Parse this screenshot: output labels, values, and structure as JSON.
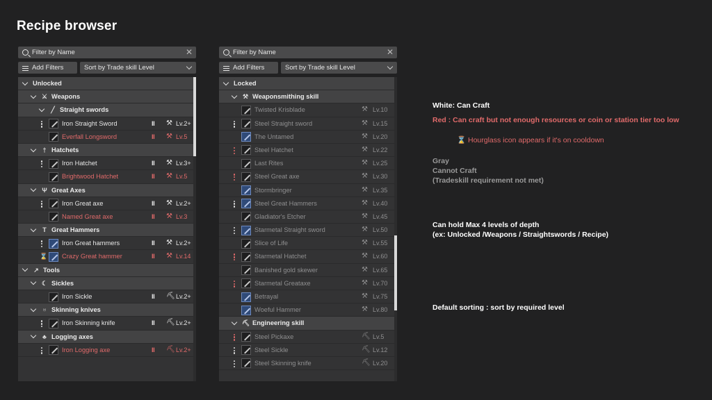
{
  "title": "Recipe browser",
  "colors": {
    "background": "#212122",
    "panel": "#333334",
    "header": "#434344",
    "red": "#e06a6a",
    "gray": "#8f8f90",
    "white": "#e6e6e6"
  },
  "left_panel": {
    "search_placeholder": "Filter by Name",
    "add_filters": "Add Filters",
    "sort": "Sort by Trade skill Level",
    "groups": [
      {
        "label": "Unlocked",
        "level": 1
      },
      {
        "label": "Weapons",
        "level": 2,
        "icon": "crossed-swords-icon"
      },
      {
        "label": "Straight swords",
        "level": 3,
        "icon": "sword-icon"
      },
      {
        "name": "Iron Straight Sword",
        "status": "white",
        "level": "Lv.2+",
        "dots": true
      },
      {
        "name": "Everfall Longsword",
        "status": "red",
        "level": "Lv.5",
        "dots": false
      },
      {
        "label": "Hatchets",
        "level": 2,
        "icon": "hatchet-icon"
      },
      {
        "name": "Iron Hatchet",
        "status": "white",
        "level": "Lv.3+",
        "dots": true
      },
      {
        "name": "Brightwood Hatchet",
        "status": "red",
        "level": "Lv.5",
        "dots": false
      },
      {
        "label": "Great Axes",
        "level": 2,
        "icon": "great-axe-icon"
      },
      {
        "name": "Iron Great axe",
        "status": "white",
        "level": "Lv.2+",
        "dots": true
      },
      {
        "name": "Named Great axe",
        "status": "red",
        "level": "Lv.3",
        "dots": false
      },
      {
        "label": "Great Hammers",
        "level": 2,
        "icon": "hammer-icon"
      },
      {
        "name": "Iron Great hammers",
        "status": "white",
        "level": "Lv.2+",
        "dots": true
      },
      {
        "name": "Crazy Great hammer",
        "status": "red",
        "level": "Lv.14",
        "dots": false,
        "cooldown": true
      },
      {
        "label": "Tools",
        "level": 1,
        "icon": "tools-icon"
      },
      {
        "label": "Sickles",
        "level": 2,
        "icon": "sickle-icon"
      },
      {
        "name": "Iron Sickle",
        "status": "white",
        "level": "Lv.2+",
        "dots": false
      },
      {
        "label": "Skinning knives",
        "level": 2,
        "icon": "knife-icon"
      },
      {
        "name": "Iron Skinning knife",
        "status": "white",
        "level": "Lv.2+",
        "dots": true
      },
      {
        "label": "Logging axes",
        "level": 2,
        "icon": "tree-icon"
      },
      {
        "name": "Iron Logging axe",
        "status": "red",
        "level": "Lv.2+",
        "dots": true
      }
    ]
  },
  "right_panel": {
    "search_placeholder": "Filter by Name",
    "add_filters": "Add Filters",
    "sort": "Sort by Trade skill Level",
    "groups": [
      {
        "label": "Locked",
        "level": 1
      },
      {
        "label": "Weaponsmithing skill",
        "level": 2,
        "icon": "anvil-icon"
      },
      {
        "name": "Twisted Krisblade",
        "level": "Lv.10",
        "dots": false,
        "icon_color": "dark"
      },
      {
        "name": "Steel Straight sword",
        "level": "Lv.15",
        "dots": true,
        "icon_color": "dark"
      },
      {
        "name": "The Untamed",
        "level": "Lv.20",
        "dots": false,
        "icon_color": "blue"
      },
      {
        "name": "Steel Hatchet",
        "level": "Lv.22",
        "dots": true,
        "dots_red": true,
        "icon_color": "dark"
      },
      {
        "name": "Last Rites",
        "level": "Lv.25",
        "dots": false,
        "icon_color": "dark"
      },
      {
        "name": "Steel Great axe",
        "level": "Lv.30",
        "dots": true,
        "dots_red": true,
        "icon_color": "dark"
      },
      {
        "name": "Stormbringer",
        "level": "Lv.35",
        "dots": false,
        "icon_color": "blue"
      },
      {
        "name": "Steel Great Hammers",
        "level": "Lv.40",
        "dots": true,
        "icon_color": "blue"
      },
      {
        "name": "Gladiator's Etcher",
        "level": "Lv.45",
        "dots": false,
        "icon_color": "dark"
      },
      {
        "name": "Starmetal Straight sword",
        "level": "Lv.50",
        "dots": true,
        "icon_color": "blue"
      },
      {
        "name": "Slice of Life",
        "level": "Lv.55",
        "dots": false,
        "icon_color": "dark"
      },
      {
        "name": "Starmetal Hatchet",
        "level": "Lv.60",
        "dots": true,
        "dots_red": true,
        "icon_color": "dark"
      },
      {
        "name": "Banished gold skewer",
        "level": "Lv.65",
        "dots": false,
        "icon_color": "dark"
      },
      {
        "name": "Starmetal Greataxe",
        "level": "Lv.70",
        "dots": true,
        "dots_red": true,
        "icon_color": "dark"
      },
      {
        "name": "Betrayal",
        "level": "Lv.75",
        "dots": false,
        "icon_color": "blue"
      },
      {
        "name": "Woeful Hammer",
        "level": "Lv.80",
        "dots": false,
        "icon_color": "blue"
      },
      {
        "label": "Engineering skill",
        "level": 2,
        "icon": "engineering-icon"
      },
      {
        "name": "Steel Pickaxe",
        "level": "Lv.5",
        "dots": true,
        "dots_red": true,
        "icon_color": "dark"
      },
      {
        "name": "Steel Sickle",
        "level": "Lv.12",
        "dots": true,
        "icon_color": "dark"
      },
      {
        "name": "Steel Skinning knife",
        "level": "Lv.20",
        "dots": true,
        "icon_color": "dark"
      }
    ]
  },
  "notes": {
    "white": "White: Can Craft",
    "red": "Red : Can craft but not enough resources or coin or station tier too low",
    "hourglass": "⌛ Hourglass icon appears if it's on cooldown",
    "gray_1": "Gray",
    "gray_2": "Cannot Craft",
    "gray_3": "(Tradeskill requirement not met)",
    "depth_1": "Can hold Max 4 levels of depth",
    "depth_2": "(ex: Unlocked /Weapons / Straightswords / Recipe)",
    "sorting": "Default sorting : sort by required level"
  }
}
